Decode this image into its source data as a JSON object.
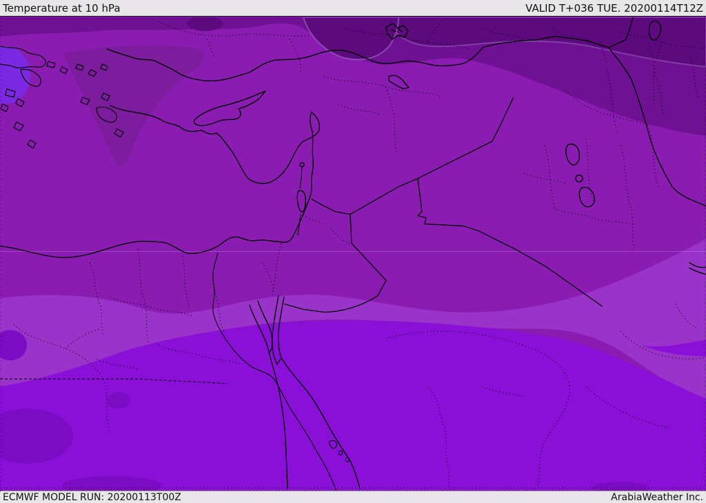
{
  "header": {
    "title": "Temperature at 10 hPa",
    "valid_label": "VALID T+036 TUE. 20200114T12Z"
  },
  "footer": {
    "model_run": "ECMWF MODEL RUN: 20200113T00Z",
    "brand": "ArabiaWeather Inc."
  },
  "map": {
    "description": "ECMWF filled-contour temperature field at 10 hPa over the Middle East",
    "region": "Eastern Mediterranean, Turkey, Levant, Egypt, Arabian Peninsula, Iraq"
  },
  "colors": {
    "header_bg": "#e8e6e8",
    "header_text": "#111111",
    "band_darkest": "#5c0a7e",
    "band_dark": "#6f1193",
    "band_darkmed": "#7b1d9c",
    "band_medium": "#8a1cb1",
    "band_light": "#9a33c9",
    "band_bright": "#8a10d8",
    "band_bright_dark": "#7c0bc4",
    "band_violet": "#7a2ae6",
    "border_line": "#000000"
  }
}
